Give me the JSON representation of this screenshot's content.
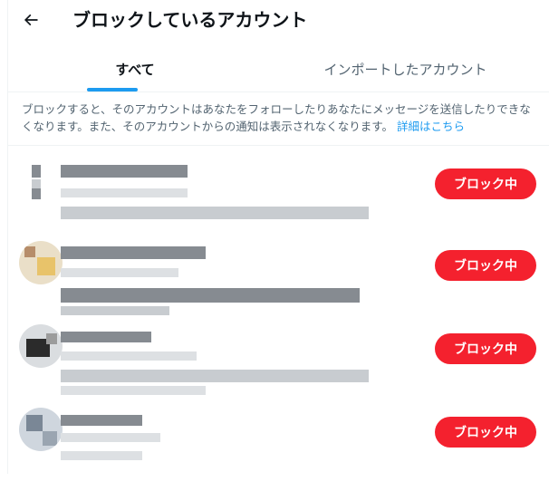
{
  "header": {
    "title": "ブロックしているアカウント"
  },
  "tabs": [
    {
      "label": "すべて",
      "active": true
    },
    {
      "label": "インポートしたアカウント",
      "active": false
    }
  ],
  "description": {
    "text": "ブロックすると、そのアカウントはあなたをフォローしたりあなたにメッセージを送信したりできなくなります。また、そのアカウントからの通知は表示されなくなります。",
    "link": "詳細はこちら"
  },
  "blocked_accounts": [
    {
      "button_label": "ブロック中"
    },
    {
      "button_label": "ブロック中"
    },
    {
      "button_label": "ブロック中"
    },
    {
      "button_label": "ブロック中"
    }
  ],
  "colors": {
    "accent": "#1d9bf0",
    "block_button": "#f4212e",
    "text_primary": "#0f1419",
    "text_secondary": "#536471"
  }
}
